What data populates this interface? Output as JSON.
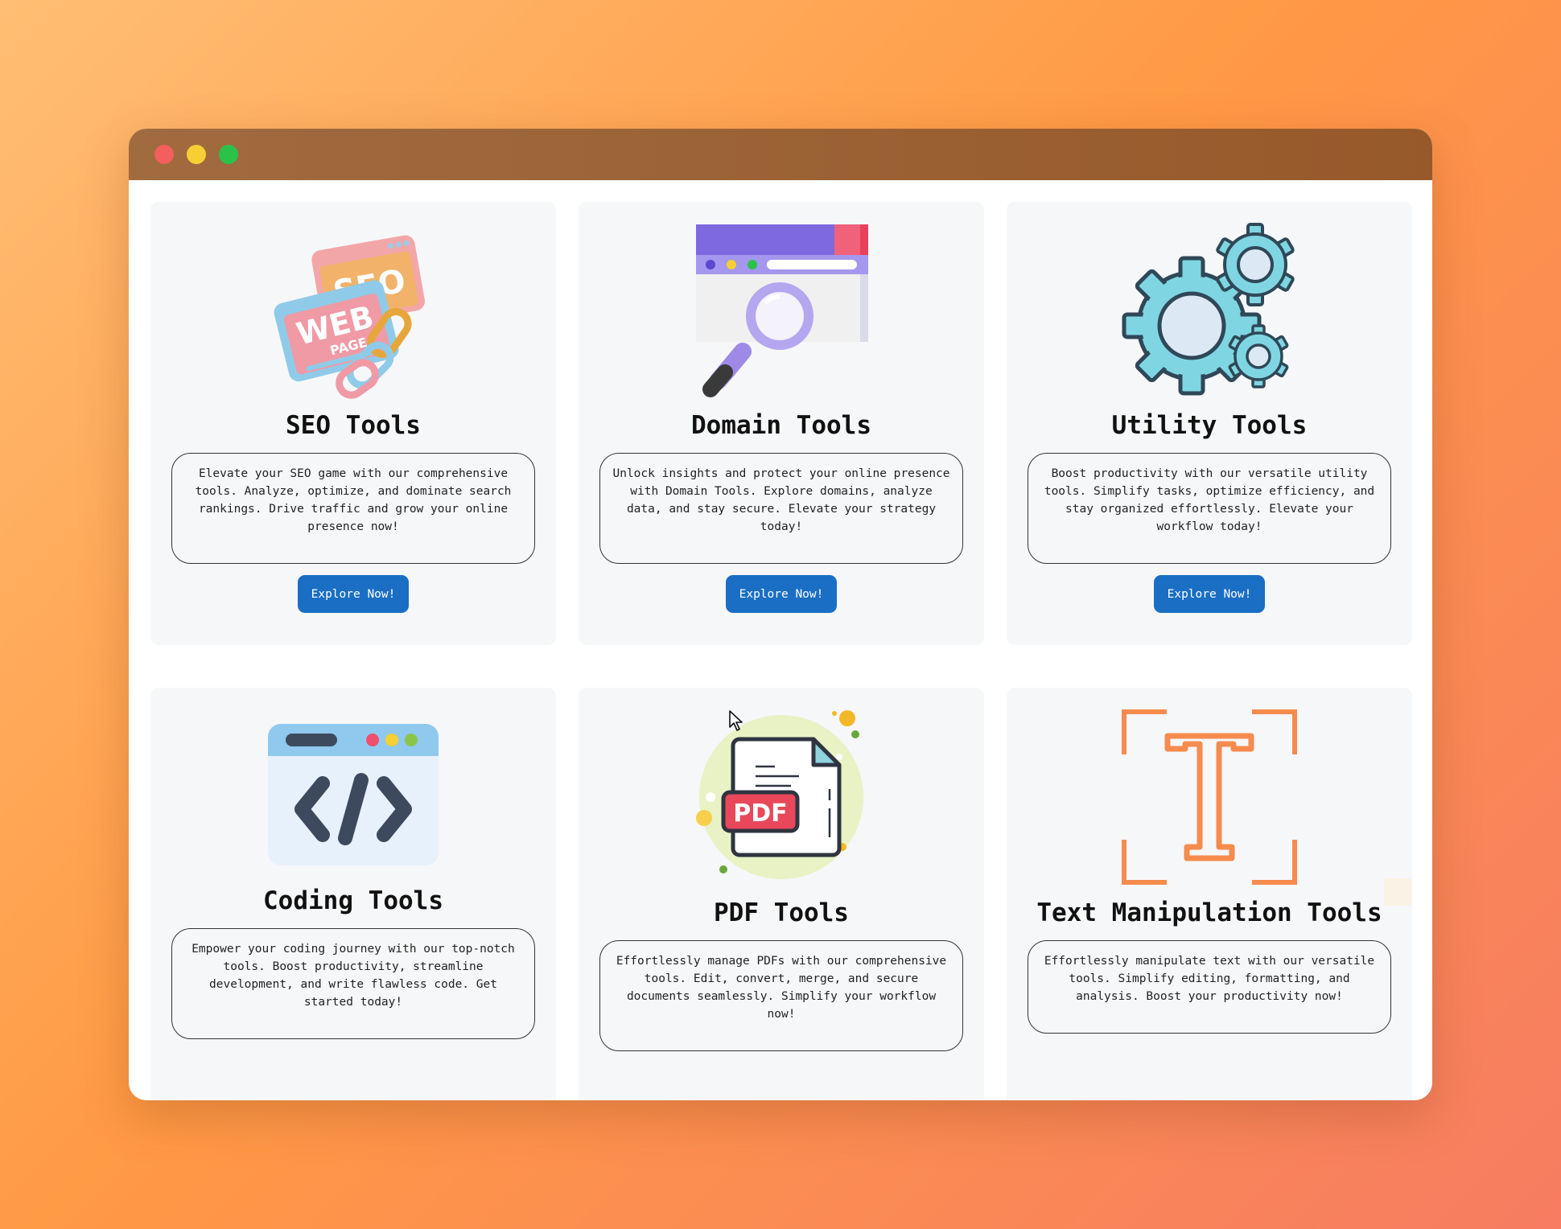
{
  "window": {
    "controls": [
      {
        "name": "close",
        "color": "#f25f5c"
      },
      {
        "name": "minimize",
        "color": "#f7cf34"
      },
      {
        "name": "maximize",
        "color": "#2bc24a"
      }
    ]
  },
  "cards": [
    {
      "title": "SEO Tools",
      "icon": "seo-webpage-icon",
      "description": "Elevate your SEO game with our comprehensive tools. Analyze, optimize, and dominate search rankings. Drive traffic and grow your online presence now!",
      "button": "Explore Now!"
    },
    {
      "title": "Domain Tools",
      "icon": "domain-search-icon",
      "description": "Unlock insights and protect your online presence with Domain Tools. Explore domains, analyze data, and stay secure. Elevate your strategy today!",
      "button": "Explore Now!"
    },
    {
      "title": "Utility Tools",
      "icon": "gears-icon",
      "description": "Boost productivity with our versatile utility tools. Simplify tasks, optimize efficiency, and stay organized effortlessly. Elevate your workflow today!",
      "button": "Explore Now!"
    },
    {
      "title": "Coding Tools",
      "icon": "code-window-icon",
      "description": "Empower your coding journey with our top-notch tools. Boost productivity, streamline development, and write flawless code. Get started today!"
    },
    {
      "title": "PDF Tools",
      "icon": "pdf-document-icon",
      "description": "Effortlessly manage PDFs with our comprehensive tools. Edit, convert, merge, and secure documents seamlessly. Simplify your workflow now!"
    },
    {
      "title": "Text Manipulation Tools",
      "icon": "text-frame-icon",
      "description": "Effortlessly manipulate text with our versatile tools. Simplify editing, formatting, and analysis. Boost your productivity now!"
    }
  ],
  "icons": {
    "pdf_label": "PDF",
    "seo_label": "SEO",
    "web_label": "WEB",
    "page_label": "PAGE",
    "text_letter": "T"
  }
}
